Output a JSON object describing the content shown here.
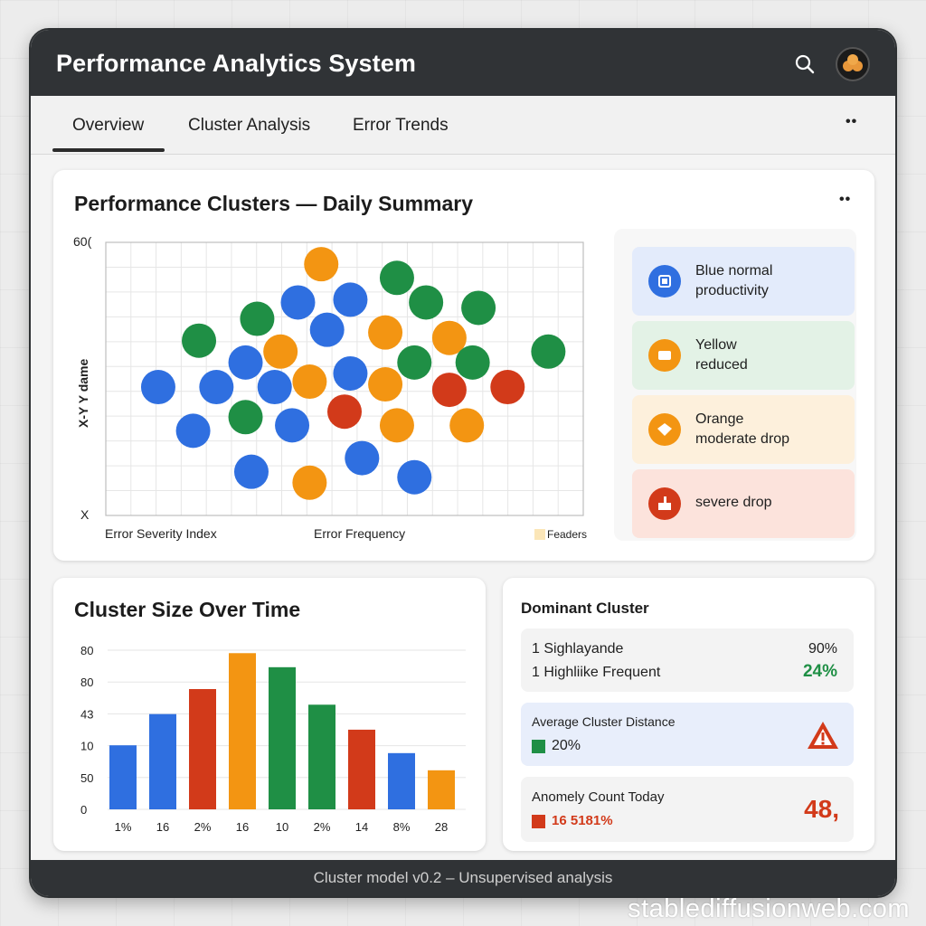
{
  "app": {
    "title": "Performance Analytics System",
    "footer": "Cluster model v0.2 – Unsupervised analysis",
    "watermark": "stablediffusionweb.com"
  },
  "tabs": [
    {
      "label": "Overview",
      "active": true
    },
    {
      "label": "Cluster Analysis",
      "active": false
    },
    {
      "label": "Error Trends",
      "active": false
    }
  ],
  "colors": {
    "blue": "#2f6fe0",
    "green": "#1f8f45",
    "orange": "#f39512",
    "red": "#d23a1a",
    "titlebar": "#303336"
  },
  "icons": {
    "search": "search-icon",
    "avatar": "avatar",
    "more": "more-options-icon",
    "warning": "warning-icon"
  },
  "scatter_card": {
    "title": "Performance Clusters — Daily Summary",
    "y_axis_label": "X-Y Y dame",
    "y_top_tick": "60(",
    "y_bottom_tick": "X",
    "x_label_left": "Error Severity Index",
    "x_label_mid": "Error Frequency",
    "x_label_right": "Feaders",
    "legend": [
      {
        "label": "Blue  normal\nproductivity",
        "color": "blue"
      },
      {
        "label": "Yellow\nreduced",
        "color": "orange"
      },
      {
        "label": "Orange\nmoderate drop",
        "color": "orange"
      },
      {
        "label": "severe drop",
        "color": "red"
      }
    ]
  },
  "bar_card": {
    "title": "Cluster Size Over Time"
  },
  "dominant_card": {
    "title": "Dominant Cluster",
    "row1_label": "1 Sighlayande",
    "row1_value": "90%",
    "row2_label": "1  Highliike Frequent",
    "row2_value": "24%",
    "distance_title": "Average Cluster Distance",
    "distance_value": "20%",
    "anomaly_title": "Anomely Count Today",
    "anomaly_sub": "16 5181%",
    "anomaly_value": "48,"
  },
  "chart_data": [
    {
      "type": "scatter",
      "title": "Performance Clusters — Daily Summary",
      "xlabel": "Error Severity Index",
      "ylabel": "X-Y Y dame",
      "points": [
        {
          "x": 3.7,
          "y": 9.2,
          "cluster": "orange"
        },
        {
          "x": 5.0,
          "y": 8.7,
          "cluster": "green"
        },
        {
          "x": 2.6,
          "y": 7.2,
          "cluster": "green"
        },
        {
          "x": 3.3,
          "y": 7.8,
          "cluster": "blue"
        },
        {
          "x": 4.2,
          "y": 7.9,
          "cluster": "blue"
        },
        {
          "x": 5.5,
          "y": 7.8,
          "cluster": "green"
        },
        {
          "x": 6.4,
          "y": 7.6,
          "cluster": "green"
        },
        {
          "x": 1.6,
          "y": 6.4,
          "cluster": "green"
        },
        {
          "x": 3.0,
          "y": 6.0,
          "cluster": "orange"
        },
        {
          "x": 3.8,
          "y": 6.8,
          "cluster": "blue"
        },
        {
          "x": 4.8,
          "y": 6.7,
          "cluster": "orange"
        },
        {
          "x": 5.9,
          "y": 6.5,
          "cluster": "orange"
        },
        {
          "x": 2.4,
          "y": 5.6,
          "cluster": "blue"
        },
        {
          "x": 5.3,
          "y": 5.6,
          "cluster": "green"
        },
        {
          "x": 6.3,
          "y": 5.6,
          "cluster": "green"
        },
        {
          "x": 7.6,
          "y": 6.0,
          "cluster": "green"
        },
        {
          "x": 0.9,
          "y": 4.7,
          "cluster": "blue"
        },
        {
          "x": 1.9,
          "y": 4.7,
          "cluster": "blue"
        },
        {
          "x": 2.9,
          "y": 4.7,
          "cluster": "blue"
        },
        {
          "x": 3.5,
          "y": 4.9,
          "cluster": "orange"
        },
        {
          "x": 4.2,
          "y": 5.2,
          "cluster": "blue"
        },
        {
          "x": 4.8,
          "y": 4.8,
          "cluster": "orange"
        },
        {
          "x": 5.9,
          "y": 4.6,
          "cluster": "red"
        },
        {
          "x": 6.9,
          "y": 4.7,
          "cluster": "red"
        },
        {
          "x": 1.5,
          "y": 3.1,
          "cluster": "blue"
        },
        {
          "x": 2.4,
          "y": 3.6,
          "cluster": "green"
        },
        {
          "x": 3.2,
          "y": 3.3,
          "cluster": "blue"
        },
        {
          "x": 4.1,
          "y": 3.8,
          "cluster": "red"
        },
        {
          "x": 5.0,
          "y": 3.3,
          "cluster": "orange"
        },
        {
          "x": 6.2,
          "y": 3.3,
          "cluster": "orange"
        },
        {
          "x": 2.5,
          "y": 1.6,
          "cluster": "blue"
        },
        {
          "x": 3.5,
          "y": 1.2,
          "cluster": "orange"
        },
        {
          "x": 4.4,
          "y": 2.1,
          "cluster": "blue"
        },
        {
          "x": 5.3,
          "y": 1.4,
          "cluster": "blue"
        }
      ]
    },
    {
      "type": "bar",
      "title": "Cluster Size Over Time",
      "categories": [
        "1%",
        "16",
        "2%",
        "16",
        "10",
        "2%",
        "14",
        "8%",
        "28"
      ],
      "ytick_labels": [
        "0",
        "50",
        "10",
        "43",
        "80",
        "80"
      ],
      "values": [
        2.05,
        3.05,
        3.85,
        5.0,
        4.55,
        3.35,
        2.55,
        1.8,
        1.25
      ],
      "colors": [
        "blue",
        "blue",
        "red",
        "orange",
        "green",
        "green",
        "red",
        "blue",
        "orange"
      ],
      "ylim": [
        0,
        5.5
      ]
    }
  ]
}
